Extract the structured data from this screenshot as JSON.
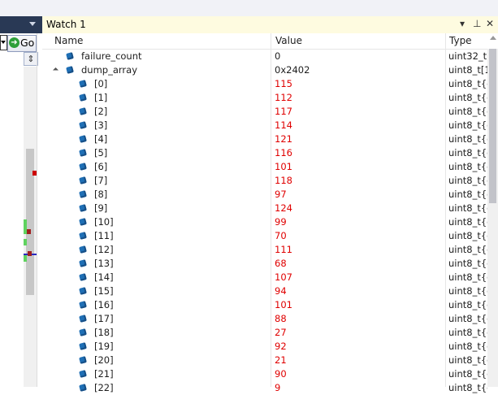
{
  "left": {
    "go_label": "Go",
    "go_icon": "go-arrow-icon"
  },
  "watch": {
    "title": "Watch 1",
    "controls": {
      "dropdown": "▾",
      "pin": "⊥",
      "close": "✕"
    },
    "columns": {
      "name": "Name",
      "value": "Value",
      "type": "Type"
    },
    "rows": [
      {
        "name": "failure_count",
        "value": "0",
        "type": "uint32_t{",
        "changed": false,
        "level": 0,
        "expander": false
      },
      {
        "name": "dump_array",
        "value": "0x2402",
        "type": "uint8_t[1",
        "changed": false,
        "level": 0,
        "expander": true
      },
      {
        "name": "[0]",
        "value": "115",
        "type": "uint8_t{c",
        "changed": true,
        "level": 1
      },
      {
        "name": "[1]",
        "value": "112",
        "type": "uint8_t{c",
        "changed": true,
        "level": 1
      },
      {
        "name": "[2]",
        "value": "117",
        "type": "uint8_t{c",
        "changed": true,
        "level": 1
      },
      {
        "name": "[3]",
        "value": "114",
        "type": "uint8_t{c",
        "changed": true,
        "level": 1
      },
      {
        "name": "[4]",
        "value": "121",
        "type": "uint8_t{c",
        "changed": true,
        "level": 1
      },
      {
        "name": "[5]",
        "value": "116",
        "type": "uint8_t{c",
        "changed": true,
        "level": 1
      },
      {
        "name": "[6]",
        "value": "101",
        "type": "uint8_t{c",
        "changed": true,
        "level": 1
      },
      {
        "name": "[7]",
        "value": "118",
        "type": "uint8_t{c",
        "changed": true,
        "level": 1
      },
      {
        "name": "[8]",
        "value": "97",
        "type": "uint8_t{c",
        "changed": true,
        "level": 1
      },
      {
        "name": "[9]",
        "value": "124",
        "type": "uint8_t{c",
        "changed": true,
        "level": 1
      },
      {
        "name": "[10]",
        "value": "99",
        "type": "uint8_t{c",
        "changed": true,
        "level": 1
      },
      {
        "name": "[11]",
        "value": "70",
        "type": "uint8_t{c",
        "changed": true,
        "level": 1
      },
      {
        "name": "[12]",
        "value": "111",
        "type": "uint8_t{c",
        "changed": true,
        "level": 1
      },
      {
        "name": "[13]",
        "value": "68",
        "type": "uint8_t{c",
        "changed": true,
        "level": 1
      },
      {
        "name": "[14]",
        "value": "107",
        "type": "uint8_t{c",
        "changed": true,
        "level": 1
      },
      {
        "name": "[15]",
        "value": "94",
        "type": "uint8_t{c",
        "changed": true,
        "level": 1
      },
      {
        "name": "[16]",
        "value": "101",
        "type": "uint8_t{c",
        "changed": true,
        "level": 1
      },
      {
        "name": "[17]",
        "value": "88",
        "type": "uint8_t{c",
        "changed": true,
        "level": 1
      },
      {
        "name": "[18]",
        "value": "27",
        "type": "uint8_t{c",
        "changed": true,
        "level": 1
      },
      {
        "name": "[19]",
        "value": "92",
        "type": "uint8_t{c",
        "changed": true,
        "level": 1
      },
      {
        "name": "[20]",
        "value": "21",
        "type": "uint8_t{c",
        "changed": true,
        "level": 1
      },
      {
        "name": "[21]",
        "value": "90",
        "type": "uint8_t{c",
        "changed": true,
        "level": 1
      },
      {
        "name": "[22]",
        "value": "9",
        "type": "uint8_t{c",
        "changed": true,
        "level": 1
      }
    ]
  },
  "colors": {
    "changed_value": "#e00000",
    "normal_value": "#1e1e1e",
    "title_bar_bg": "#fefbe0",
    "left_titlebar_bg": "#293955",
    "type_icon": "#1f6fb5"
  }
}
